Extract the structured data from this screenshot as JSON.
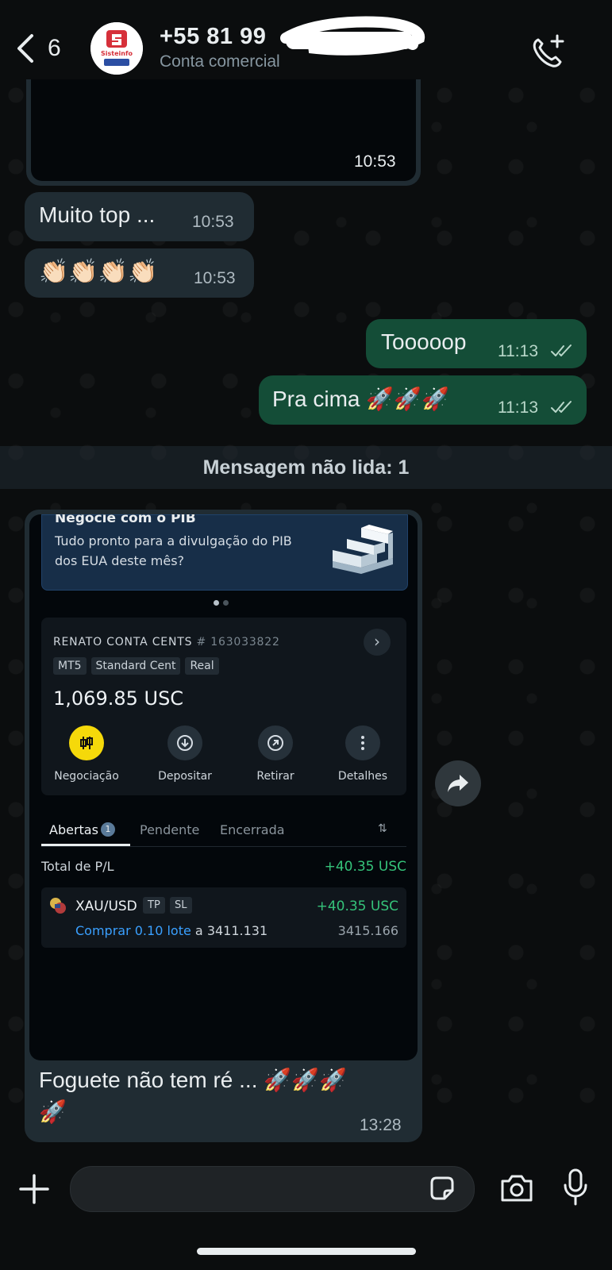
{
  "header": {
    "back_count": "6",
    "contact_name": "+55 81 99",
    "contact_subtitle": "Conta comercial",
    "avatar_text": "Sisteinfo"
  },
  "messages": {
    "image_top_time": "10:53",
    "m1_text": "Muito top ...",
    "m1_time": "10:53",
    "m2_text": "👏🏻👏🏻👏🏻👏🏻",
    "m2_time": "10:53",
    "m3_text": "Tooooop",
    "m3_time": "11:13",
    "m4_text": "Pra cima 🚀🚀🚀",
    "m4_time": "11:13",
    "unread_label": "Mensagem não lida: 1",
    "last_caption_line1": "Foguete não tem ré ... 🚀🚀🚀",
    "last_caption_line2": "🚀",
    "last_time": "13:28"
  },
  "screenshot": {
    "banner_title": "Negocie com o PIB",
    "banner_text": "Tudo pronto para a divulgação do PIB dos EUA deste mês?",
    "account_name": "RENATO CONTA CENTS",
    "account_number": "# 163033822",
    "tags": [
      "MT5",
      "Standard Cent",
      "Real"
    ],
    "balance": "1,069.85 USC",
    "actions": [
      "Negociação",
      "Depositar",
      "Retirar",
      "Detalhes"
    ],
    "tabs": [
      "Abertas",
      "Pendente",
      "Encerrada"
    ],
    "open_count": "1",
    "total_pl_label": "Total de P/L",
    "total_pl_value": "+40.35 USC",
    "position": {
      "symbol": "XAU/USD",
      "tag_tp": "TP",
      "tag_sl": "SL",
      "pl": "+40.35 USC",
      "order": "Comprar 0.10 lote",
      "open_prefix": "a",
      "open_price": "3411.131",
      "current_price": "3415.166"
    }
  },
  "colors": {
    "incoming_bubble": "#202c33",
    "outgoing_bubble": "#144d37",
    "profit_green": "#35c37a",
    "link_blue": "#3aa0ff",
    "trade_yellow": "#f5d90a"
  },
  "icons": [
    "back-chevron-icon",
    "add-call-icon",
    "forward-icon",
    "plus-icon",
    "sticker-icon",
    "camera-icon",
    "microphone-icon",
    "double-check-icon"
  ]
}
